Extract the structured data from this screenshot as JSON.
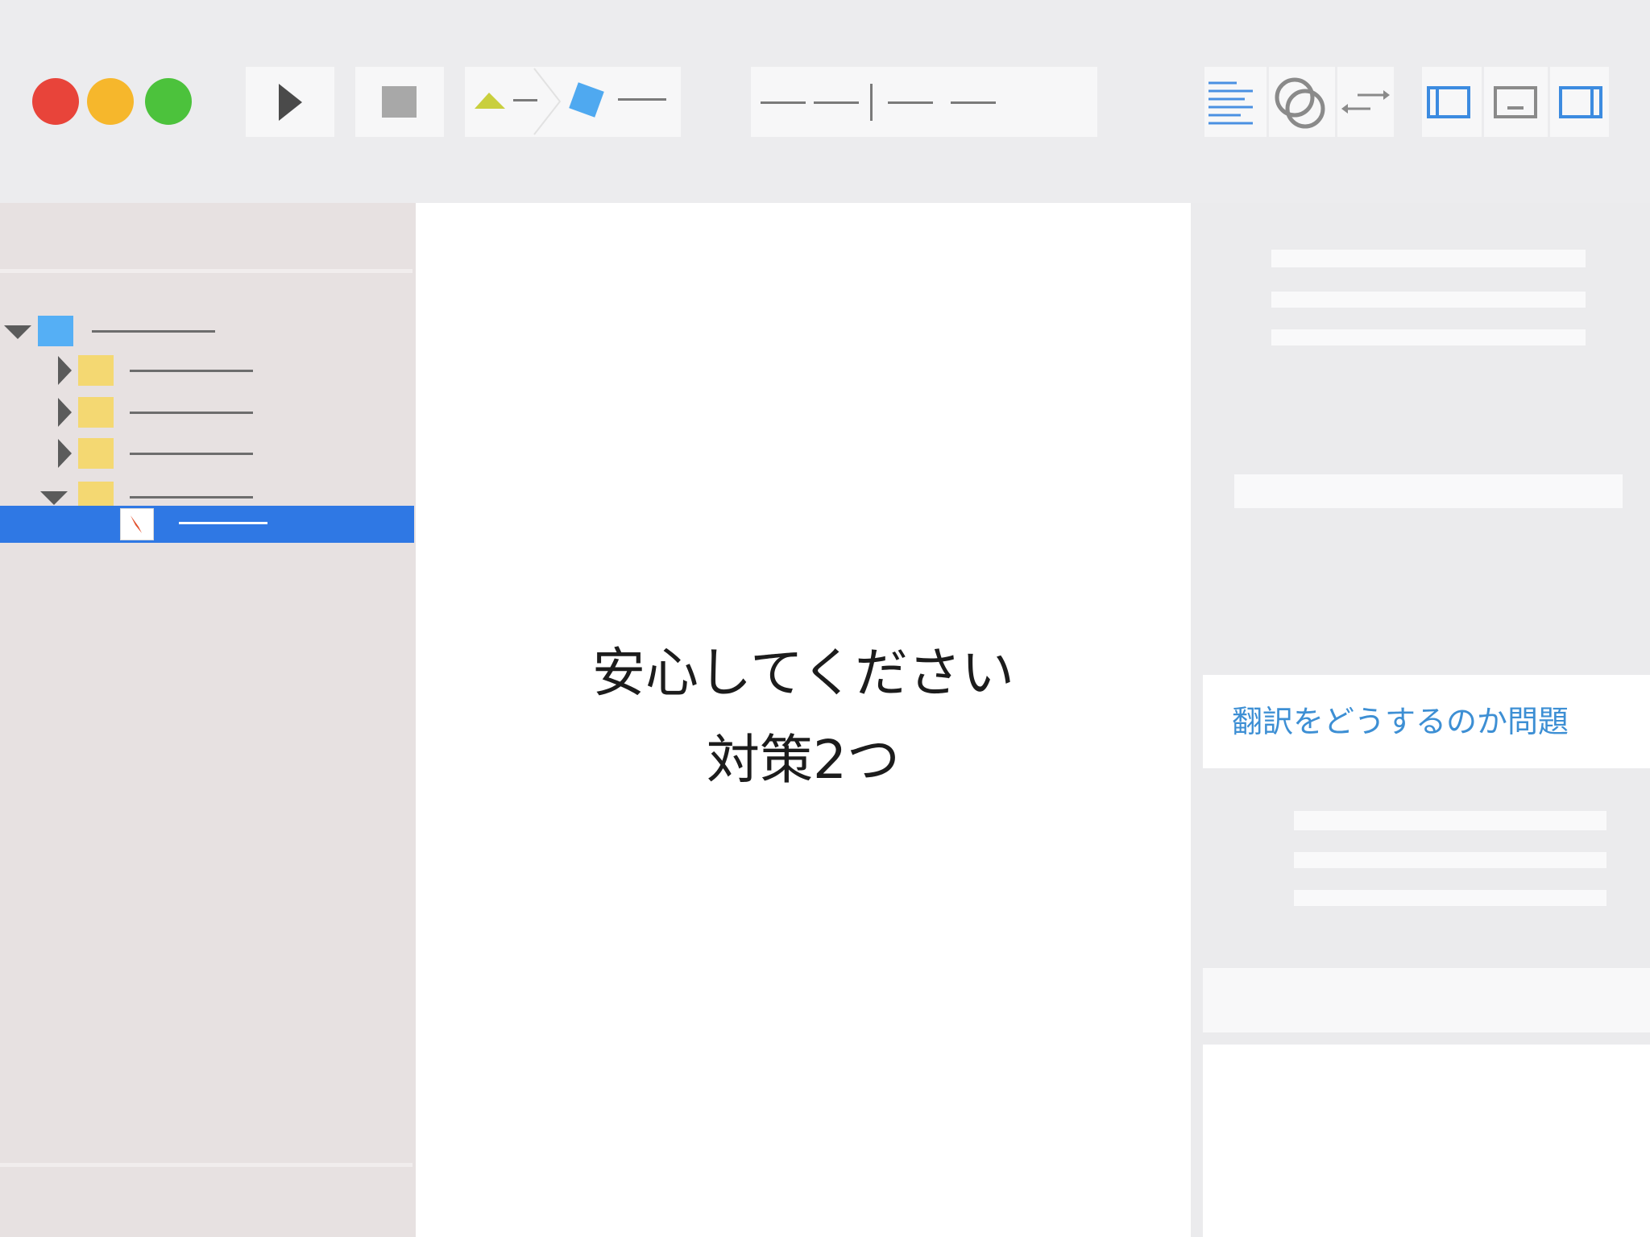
{
  "window": {
    "controls": [
      "close",
      "minimize",
      "zoom"
    ],
    "colors": {
      "close": "#e8443a",
      "minimize": "#f6b72c",
      "zoom": "#4cc23c",
      "selection": "#2f78e4",
      "question_text": "#3d8fd4"
    }
  },
  "toolbar": {
    "run_icon": "play-icon",
    "stop_icon": "stop-icon",
    "scheme_icons": [
      "triangle-icon",
      "diamond-icon"
    ],
    "editor_icons": [
      "text-lines-icon",
      "linked-rings-icon",
      "swap-arrows-icon"
    ],
    "view_icons": [
      "left-panel-icon",
      "bottom-panel-icon",
      "right-panel-icon"
    ]
  },
  "navigator": {
    "items": [
      {
        "kind": "project",
        "expanded": true,
        "icon": "blue-square-icon"
      },
      {
        "kind": "folder",
        "expanded": false,
        "icon": "folder-icon"
      },
      {
        "kind": "folder",
        "expanded": false,
        "icon": "folder-icon"
      },
      {
        "kind": "folder",
        "expanded": false,
        "icon": "folder-icon"
      },
      {
        "kind": "folder",
        "expanded": true,
        "icon": "folder-icon"
      },
      {
        "kind": "file",
        "selected": true,
        "icon": "swift-file-icon"
      }
    ]
  },
  "editor": {
    "line1": "安心してください",
    "line2": "対策2つ"
  },
  "inspector": {
    "question": "翻訳をどうするのか問題"
  }
}
